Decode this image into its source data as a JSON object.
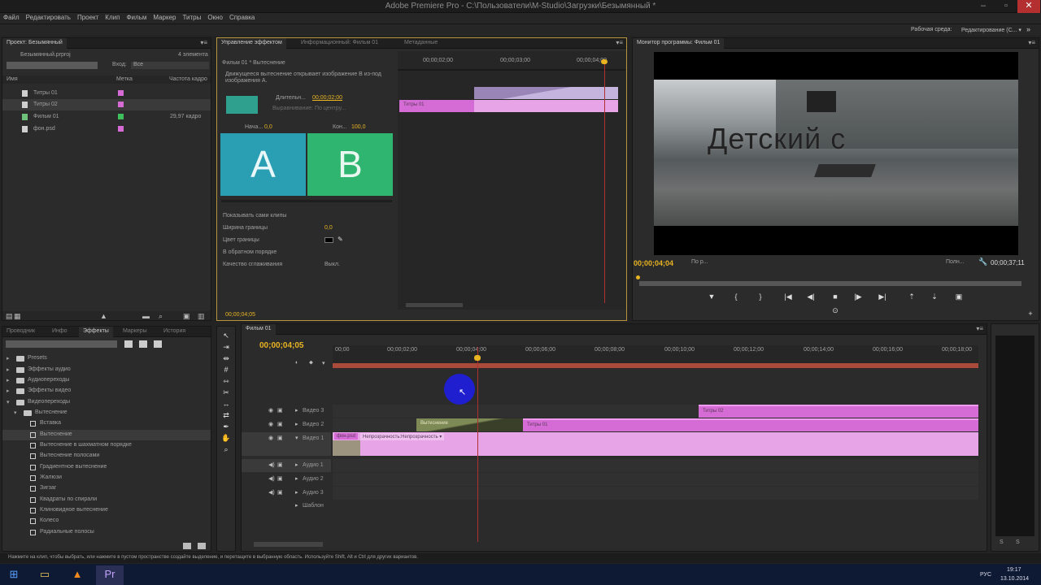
{
  "window": {
    "title": "Adobe Premiere Pro - C:\\Пользователи\\M-Studio\\Загрузки\\Безымянный *"
  },
  "menu": [
    "Файл",
    "Редактировать",
    "Проект",
    "Клип",
    "Фильм",
    "Маркер",
    "Титры",
    "Окно",
    "Справка"
  ],
  "workspace": {
    "label": "Рабочая среда:",
    "value": "Редактирование (С... ▾"
  },
  "project": {
    "tab": "Проект: Безымянный",
    "path": "Безымянный.prproj",
    "count": "4 элемента",
    "entry_label": "Вход:",
    "entry_value": "Все",
    "headers": [
      "Имя",
      "Метка",
      "Частота кадро"
    ],
    "items": [
      {
        "name": "Титры 01",
        "color": "#d66bd6",
        "rate": ""
      },
      {
        "name": "Титры 02",
        "color": "#d66bd6",
        "rate": ""
      },
      {
        "name": "Фильм 01",
        "color": "#3fbf5c",
        "rate": "29,97 кадро"
      },
      {
        "name": "фон.psd",
        "color": "#d66bd6",
        "rate": ""
      }
    ]
  },
  "effect_controls": {
    "tabs": [
      "Управление эффектом",
      "Информационный: Фильм 01",
      "Метаданные"
    ],
    "sequence": "Фильм 01 * Вытеснение",
    "description": "Движущееся вытеснение открывает изображение В из-под изображения А.",
    "duration_label": "Длительн...",
    "duration_value": "00;00;02;00",
    "alignment_label": "Выравнивание:",
    "alignment_value": "По центру...",
    "start_label": "Нача...",
    "start_value": "0,0",
    "end_label": "Кон...",
    "end_value": "100,0",
    "a_label": "A",
    "b_label": "B",
    "params": [
      {
        "label": "Показывать сами клипы",
        "value": ""
      },
      {
        "label": "Ширина границы",
        "value": "0,0"
      },
      {
        "label": "Цвет границы",
        "value": ""
      },
      {
        "label": "В обратном порядке",
        "value": ""
      },
      {
        "label": "Качество сглаживания",
        "value": "Выкл."
      }
    ],
    "ruler": [
      "00;00;02;00",
      "00;00;03;00",
      "00;00;04;00"
    ],
    "clip_label": "Титры 01",
    "footer_tc": "00;00;04;05"
  },
  "program_monitor": {
    "tab": "Монитор программы: Фильм 01",
    "overlay_text": "Детский с",
    "timecode": "00;00;04;04",
    "fit": "По р...",
    "quality": "Полн...",
    "duration": "00;00;37;11"
  },
  "effects_panel": {
    "tabs": [
      "Проводник",
      "Инфо",
      "Эффекты",
      "Маркеры",
      "История"
    ],
    "items": [
      {
        "label": "Presets",
        "level": 0,
        "kind": "folder"
      },
      {
        "label": "Эффекты аудио",
        "level": 0,
        "kind": "folder"
      },
      {
        "label": "Аудиопереходы",
        "level": 0,
        "kind": "folder"
      },
      {
        "label": "Эффекты видео",
        "level": 0,
        "kind": "folder"
      },
      {
        "label": "Видеопереходы",
        "level": 0,
        "kind": "folder"
      },
      {
        "label": "Вытеснение",
        "level": 1,
        "kind": "folder"
      },
      {
        "label": "Вставка",
        "level": 2,
        "kind": "effect"
      },
      {
        "label": "Вытеснение",
        "level": 2,
        "kind": "effect"
      },
      {
        "label": "Вытеснение в шахматном порядке",
        "level": 2,
        "kind": "effect"
      },
      {
        "label": "Вытеснение полосами",
        "level": 2,
        "kind": "effect"
      },
      {
        "label": "Градиентное вытеснение",
        "level": 2,
        "kind": "effect"
      },
      {
        "label": "Жалюзи",
        "level": 2,
        "kind": "effect"
      },
      {
        "label": "Зигзаг",
        "level": 2,
        "kind": "effect"
      },
      {
        "label": "Квадраты по спирали",
        "level": 2,
        "kind": "effect"
      },
      {
        "label": "Клиновидное вытеснение",
        "level": 2,
        "kind": "effect"
      },
      {
        "label": "Колесо",
        "level": 2,
        "kind": "effect"
      },
      {
        "label": "Радиальные полосы",
        "level": 2,
        "kind": "effect"
      }
    ]
  },
  "timeline": {
    "tab": "Фильм 01",
    "timecode": "00;00;04;05",
    "ruler": [
      "00;00",
      "00;00;02;00",
      "00;00;04;00",
      "00;00;06;00",
      "00;00;08;00",
      "00;00;10;00",
      "00;00;12;00",
      "00;00;14;00",
      "00;00;16;00",
      "00;00;18;00"
    ],
    "tracks": {
      "v3": "Видео 3",
      "v2": "Видео 2",
      "v1": "Видео 1",
      "a1": "Аудио 1",
      "a2": "Аудио 2",
      "a3": "Аудио 3",
      "master": "Шаблон"
    },
    "clips": {
      "v3_titles02": "Титры 02",
      "v2_transition": "Вытеснение",
      "v2_titles01": "Титры 01",
      "v1_bg": "фон.psd",
      "v1_opacity": "Непрозрачность:Непрозрачность ▾"
    }
  },
  "status_bar": "Нажмите на клип, чтобы выбрать, или нажмите в пустом пространстве создайте выделение, и перетащите в выбранную область. Используйте Shift, Alt и Ctrl для других вариантов.",
  "taskbar": {
    "lang": "РУС",
    "time": "19:17",
    "date": "13.10.2014"
  }
}
